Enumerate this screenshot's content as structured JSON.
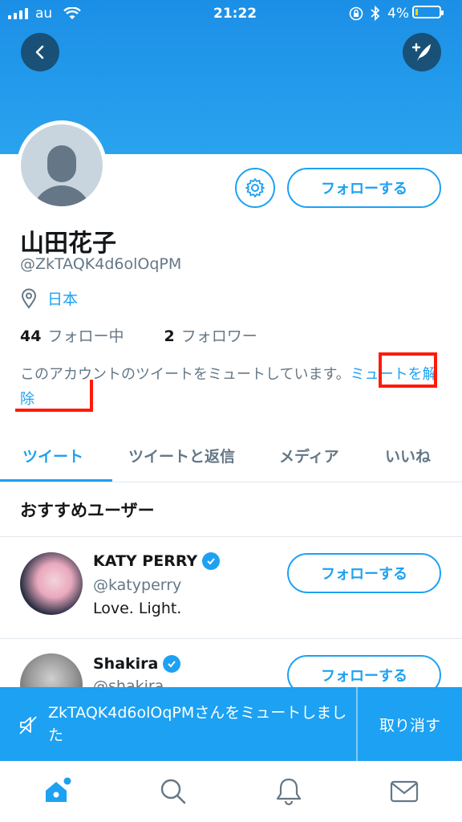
{
  "status_bar": {
    "carrier": "au",
    "time": "21:22",
    "battery": "4%"
  },
  "profile": {
    "name": "山田花子",
    "handle": "@ZkTAQK4d6olOqPM",
    "location": "日本",
    "follow_button": "フォローする",
    "following_count": "44",
    "following_label": "フォロー中",
    "followers_count": "2",
    "followers_label": "フォロワー",
    "muted_message": "このアカウントのツイートをミュートしています。",
    "unmute_link": "ミュートを解除"
  },
  "tabs": [
    "ツイート",
    "ツイートと返信",
    "メディア",
    "いいね"
  ],
  "recommended": {
    "title": "おすすめユーザー",
    "users": [
      {
        "name": "KATY PERRY",
        "handle": "@katyperry",
        "bio": "Love. Light.",
        "button": "フォローする"
      },
      {
        "name": "Shakira",
        "handle": "@shakira",
        "button": "フォローする"
      }
    ]
  },
  "toast": {
    "message": "ZkTAQK4d6olOqPMさんをミュートしました",
    "undo": "取り消す"
  },
  "bottom_nav": [
    "home-icon",
    "search-icon",
    "notifications-icon",
    "messages-icon"
  ],
  "colors": {
    "accent": "#1da1f2",
    "toast": "#1da1f2",
    "annotation": "#ff1a0a"
  }
}
